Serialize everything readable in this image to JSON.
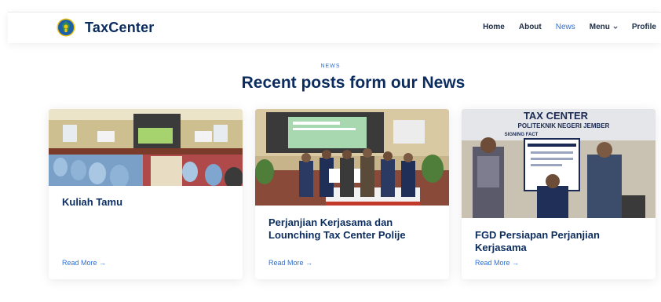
{
  "header": {
    "brand": "TaxCenter",
    "nav": [
      {
        "label": "Home"
      },
      {
        "label": "About"
      },
      {
        "label": "News"
      },
      {
        "label": "Menu"
      },
      {
        "label": "Profile"
      }
    ],
    "active_nav": "News"
  },
  "section": {
    "tag": "NEWS",
    "title": "Recent posts form our News"
  },
  "posts": [
    {
      "title": "Kuliah Tamu",
      "link": "Read More →"
    },
    {
      "title": "Perjanjian Kerjasama dan Lounching Tax Center Polije",
      "link": "Read More →"
    },
    {
      "title": "FGD Persiapan Perjanjian Kerjasama",
      "link": "Read More →",
      "photo_text": [
        "TAX CENTER",
        "POLITEKNIK NEGERI JEMBER",
        "SIGNING FACT"
      ]
    }
  ],
  "colors": {
    "brand_navy": "#0b2c5f",
    "accent_blue": "#2f6fd6",
    "nav_text": "#1b2c44"
  },
  "icons": {
    "logo": "polije-emblem-icon",
    "menu_dropdown": "chevron-down-icon",
    "read_more": "arrow-right"
  }
}
